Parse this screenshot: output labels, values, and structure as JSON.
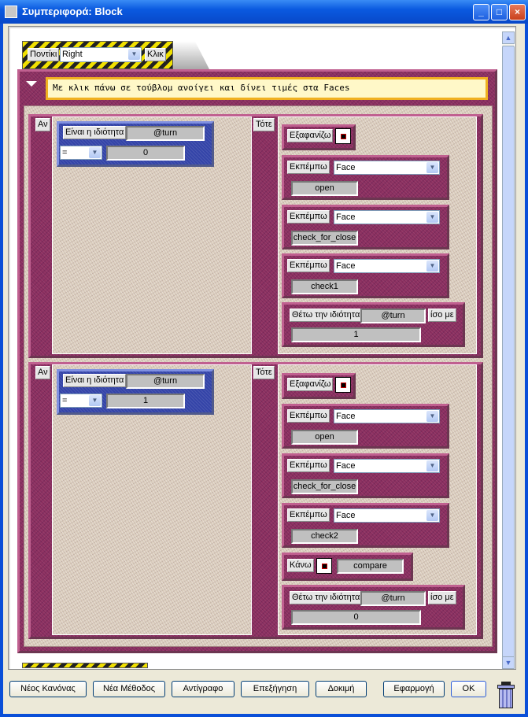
{
  "window": {
    "title": "Συμπεριφορά: Block",
    "buttons": {
      "minimize": "_",
      "maximize": "□",
      "close": "×"
    }
  },
  "trigger": {
    "device_label": "Ποντίκι",
    "device_value": "Right",
    "event_label": "Κλικ"
  },
  "comment": "Με κλικ πάνω σε τούβλομ ανοίγει και δίνει τιμές στα Faces",
  "rules": [
    {
      "if_label": "Αν",
      "then_label": "Τότε",
      "condition": {
        "label": "Είναι η ιδιότητα",
        "property": "@turn",
        "operator": "=",
        "value": "0"
      },
      "actions": [
        {
          "type": "hide",
          "label": "Εξαφανίζω"
        },
        {
          "type": "emit",
          "label": "Εκπέμπω",
          "target": "Face",
          "message": "open"
        },
        {
          "type": "emit",
          "label": "Εκπέμπω",
          "target": "Face",
          "message": "check_for_close"
        },
        {
          "type": "emit",
          "label": "Εκπέμπω",
          "target": "Face",
          "message": "check1"
        },
        {
          "type": "set",
          "label": "Θέτω την ιδιότητα",
          "property": "@turn",
          "equals": "ίσο με",
          "value": "1"
        }
      ]
    },
    {
      "if_label": "Αν",
      "then_label": "Τότε",
      "condition": {
        "label": "Είναι η ιδιότητα",
        "property": "@turn",
        "operator": "=",
        "value": "1"
      },
      "actions": [
        {
          "type": "hide",
          "label": "Εξαφανίζω"
        },
        {
          "type": "emit",
          "label": "Εκπέμπω",
          "target": "Face",
          "message": "open"
        },
        {
          "type": "emit",
          "label": "Εκπέμπω",
          "target": "Face",
          "message": "check_for_close"
        },
        {
          "type": "emit",
          "label": "Εκπέμπω",
          "target": "Face",
          "message": "check2"
        },
        {
          "type": "do",
          "label": "Κάνω",
          "method": "compare"
        },
        {
          "type": "set",
          "label": "Θέτω την ιδιότητα",
          "property": "@turn",
          "equals": "ίσο με",
          "value": "0"
        }
      ]
    }
  ],
  "footer": {
    "new_rule": "Νέος Κανόνας",
    "new_method": "Νέα Μέθοδος",
    "copy": "Αντίγραφο",
    "explain": "Επεξήγηση",
    "test": "Δοκιμή",
    "apply": "Εφαρμογή",
    "ok": "OK"
  }
}
